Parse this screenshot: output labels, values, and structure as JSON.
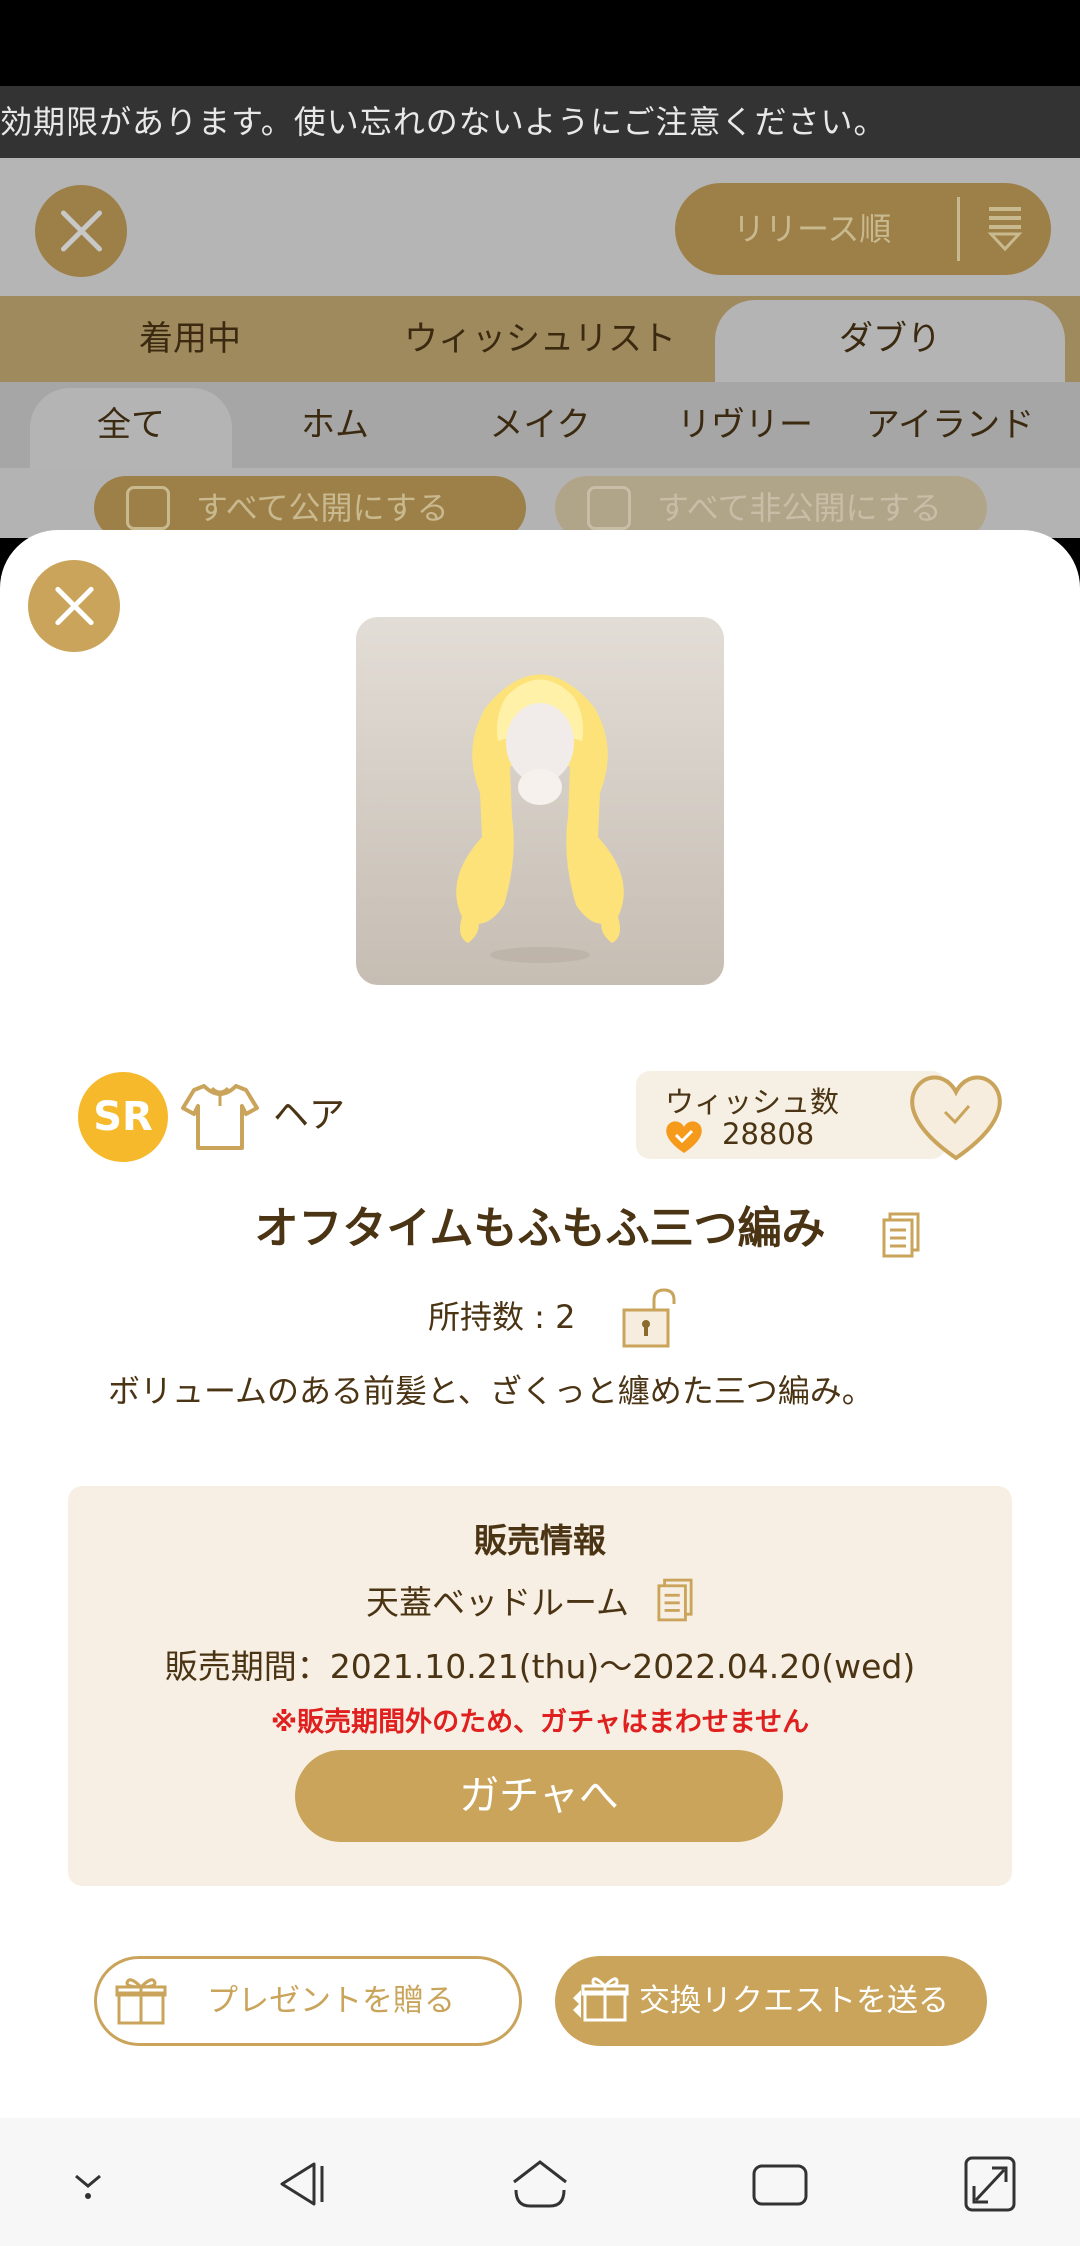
{
  "notice": {
    "text": "効期限があります。使い忘れのないようにご注意ください。"
  },
  "background": {
    "sort_label": "リリース順",
    "tabs": [
      "着用中",
      "ウィッシュリスト",
      "ダブり"
    ],
    "subtabs": [
      "全て",
      "ホム",
      "メイク",
      "リヴリー",
      "アイランド"
    ],
    "make_public": "すべて公開にする",
    "make_private": "すべて非公開にする"
  },
  "item": {
    "rarity": "SR",
    "category": "ヘア",
    "wish_label": "ウィッシュ数",
    "wish_count": "28808",
    "name": "オフタイムもふもふ三つ編み",
    "owned": "所持数 : 2",
    "description": "ボリュームのある前髪と、ざくっと纏めた三つ編み。"
  },
  "sales": {
    "title": "販売情報",
    "gacha_name": "天蓋ベッドルーム",
    "period": "販売期間：2021.10.21(thu)〜2022.04.20(wed)",
    "warning": "※販売期間外のため、ガチャはまわせません",
    "gacha_button": "ガチャへ"
  },
  "actions": {
    "present": "プレゼントを贈る",
    "trade": "交換リクエストを送る"
  },
  "colors": {
    "gold": "#c9a45a",
    "brown_text": "#4b3414",
    "warning": "#e01f1f",
    "rarity": "#f6b92c"
  }
}
